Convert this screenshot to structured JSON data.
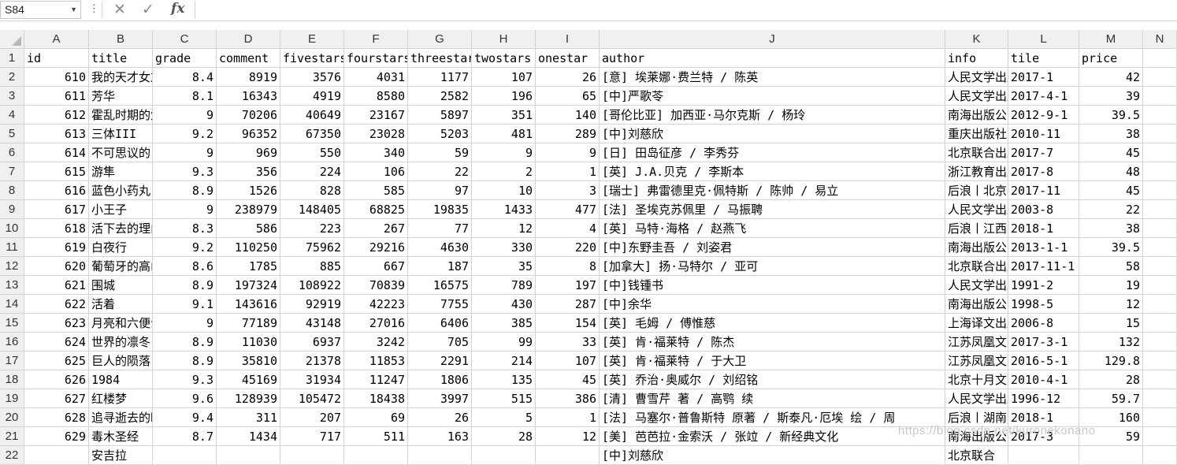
{
  "formula_bar": {
    "name_box": "S84",
    "more": "⋮",
    "cancel": "✕",
    "enter": "✓",
    "fx": "fx",
    "content": ""
  },
  "columns": [
    "",
    "A",
    "B",
    "C",
    "D",
    "E",
    "F",
    "G",
    "H",
    "I",
    "J",
    "K",
    "L",
    "M",
    "N"
  ],
  "rows": [
    {
      "n": "1",
      "c": [
        "id",
        "title",
        "grade",
        "comment",
        "fivestars",
        "fourstars",
        "threestars",
        "twostars",
        "onestar",
        "author",
        "info",
        "tile",
        "price"
      ]
    },
    {
      "n": "2",
      "c": [
        "610",
        "我的天才女友",
        "8.4",
        "8919",
        "3576",
        "4031",
        "1177",
        "107",
        "26",
        "[意] 埃莱娜·费兰特 / 陈英",
        "人民文学出版社",
        "2017-1",
        "42"
      ]
    },
    {
      "n": "3",
      "c": [
        "611",
        "芳华",
        "8.1",
        "16343",
        "4919",
        "8580",
        "2582",
        "196",
        "65",
        "[中]严歌苓",
        "人民文学出版社",
        "2017-4-1",
        "39"
      ]
    },
    {
      "n": "4",
      "c": [
        "612",
        "霍乱时期的爱情",
        "9",
        "70206",
        "40649",
        "23167",
        "5897",
        "351",
        "140",
        "[哥伦比亚] 加西亚·马尔克斯 / 杨玲",
        "南海出版公司",
        "2012-9-1",
        "39.5"
      ]
    },
    {
      "n": "5",
      "c": [
        "613",
        "三体III",
        "9.2",
        "96352",
        "67350",
        "23028",
        "5203",
        "481",
        "289",
        "[中]刘慈欣",
        "重庆出版社",
        "2010-11",
        "38"
      ]
    },
    {
      "n": "6",
      "c": [
        "614",
        "不可思议的",
        "9",
        "969",
        "550",
        "340",
        "59",
        "9",
        "9",
        "[日] 田岛征彦 / 李秀芬",
        "北京联合出版",
        "2017-7",
        "45"
      ]
    },
    {
      "n": "7",
      "c": [
        "615",
        "游隼",
        "9.3",
        "356",
        "224",
        "106",
        "22",
        "2",
        "1",
        "[英] J.A.贝克 / 李斯本",
        "浙江教育出版",
        "2017-8",
        "48"
      ]
    },
    {
      "n": "8",
      "c": [
        "616",
        "蓝色小药丸",
        "8.9",
        "1526",
        "828",
        "585",
        "97",
        "10",
        "3",
        "[瑞士] 弗雷德里克·佩特斯 / 陈帅 / 易立",
        "后浪丨北京",
        "2017-11",
        "45"
      ]
    },
    {
      "n": "9",
      "c": [
        "617",
        "小王子",
        "9",
        "238979",
        "148405",
        "68825",
        "19835",
        "1433",
        "477",
        "[法] 圣埃克苏佩里 / 马振聘",
        "人民文学出版社",
        "2003-8",
        "22"
      ]
    },
    {
      "n": "10",
      "c": [
        "618",
        "活下去的理由",
        "8.3",
        "586",
        "223",
        "267",
        "77",
        "12",
        "4",
        "[英] 马特·海格 / 赵燕飞",
        "后浪丨江西",
        "2018-1",
        "38"
      ]
    },
    {
      "n": "11",
      "c": [
        "619",
        "白夜行",
        "9.2",
        "110250",
        "75962",
        "29216",
        "4630",
        "330",
        "220",
        "[中]东野圭吾 / 刘姿君",
        "南海出版公司",
        "2013-1-1",
        "39.5"
      ]
    },
    {
      "n": "12",
      "c": [
        "620",
        "葡萄牙的高山",
        "8.6",
        "1785",
        "885",
        "667",
        "187",
        "35",
        "8",
        "[加拿大] 扬·马特尔 / 亚可",
        "北京联合出版",
        "2017-11-1",
        "58"
      ]
    },
    {
      "n": "13",
      "c": [
        "621",
        "围城",
        "8.9",
        "197324",
        "108922",
        "70839",
        "16575",
        "789",
        "197",
        "[中]钱锺书",
        "人民文学出版社",
        "1991-2",
        "19"
      ]
    },
    {
      "n": "14",
      "c": [
        "622",
        "活着",
        "9.1",
        "143616",
        "92919",
        "42223",
        "7755",
        "430",
        "287",
        "[中]余华",
        "南海出版公司",
        "1998-5",
        "12"
      ]
    },
    {
      "n": "15",
      "c": [
        "623",
        "月亮和六便士",
        "9",
        "77189",
        "43148",
        "27016",
        "6406",
        "385",
        "154",
        "[英] 毛姆 / 傅惟慈",
        "上海译文出版社",
        "2006-8",
        "15"
      ]
    },
    {
      "n": "16",
      "c": [
        "624",
        "世界的凛冬",
        "8.9",
        "11030",
        "6937",
        "3242",
        "705",
        "99",
        "33",
        "[英] 肯·福莱特 / 陈杰",
        "江苏凤凰文艺",
        "2017-3-1",
        "132"
      ]
    },
    {
      "n": "17",
      "c": [
        "625",
        "巨人的陨落",
        "8.9",
        "35810",
        "21378",
        "11853",
        "2291",
        "214",
        "107",
        "[英] 肯·福莱特 / 于大卫",
        "江苏凤凰文艺",
        "2016-5-1",
        "129.8"
      ]
    },
    {
      "n": "18",
      "c": [
        "626",
        "1984",
        "9.3",
        "45169",
        "31934",
        "11247",
        "1806",
        "135",
        "45",
        "[英] 乔治·奥威尔 / 刘绍铭",
        "北京十月文艺",
        "2010-4-1",
        "28"
      ]
    },
    {
      "n": "19",
      "c": [
        "627",
        "红楼梦",
        "9.6",
        "128939",
        "105472",
        "18438",
        "3997",
        "515",
        "386",
        "[清] 曹雪芹 著 / 高鹗 续",
        "人民文学出版社",
        "1996-12",
        "59.7"
      ]
    },
    {
      "n": "20",
      "c": [
        "628",
        "追寻逝去的时光",
        "9.4",
        "311",
        "207",
        "69",
        "26",
        "5",
        "1",
        "[法] 马塞尔·普鲁斯特 原著 / 斯泰凡·厄埃 绘 / 周",
        "后浪丨湖南",
        "2018-1",
        "160"
      ]
    },
    {
      "n": "21",
      "c": [
        "629",
        "毒木圣经",
        "8.7",
        "1434",
        "717",
        "511",
        "163",
        "28",
        "12",
        "[美] 芭芭拉·金索沃 / 张竝 / 新经典文化",
        "南海出版公司",
        "2017-3",
        "59"
      ]
    },
    {
      "n": "22",
      "c": [
        "",
        "安吉拉",
        "",
        "",
        "",
        "",
        "",
        "",
        "",
        "[中]刘慈欣",
        "北京联合",
        "",
        ""
      ]
    }
  ],
  "watermark": "https://blog.csdn.net/kuronekonano"
}
